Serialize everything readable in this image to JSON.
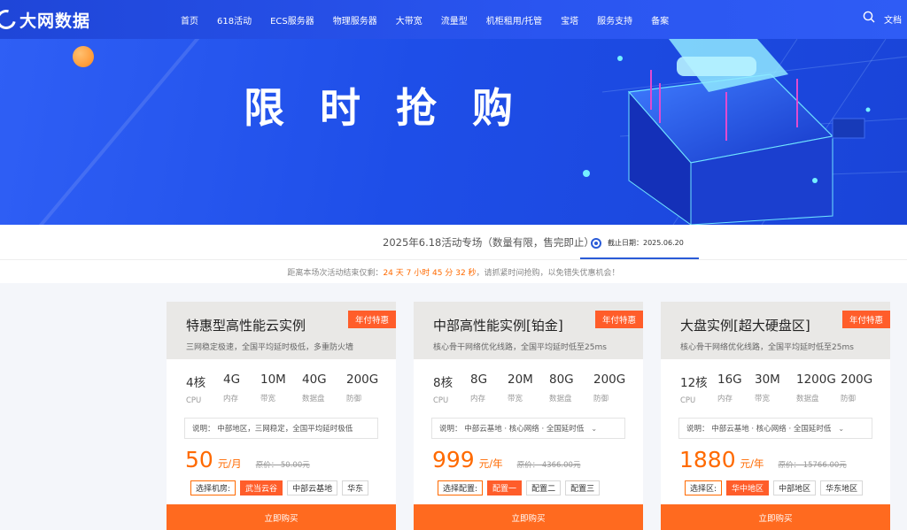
{
  "header": {
    "logo_text": "大网数据",
    "nav": [
      "首页",
      "618活动",
      "ECS服务器",
      "物理服务器",
      "大带宽",
      "流量型",
      "机柜租用/托管",
      "宝塔",
      "服务支持",
      "备案"
    ],
    "docs_label": "文档",
    "search_icon": "search-icon"
  },
  "banner": {
    "title": "限时抢购"
  },
  "info": {
    "campaign_title": "2025年6.18活动专场（数量有限，售完即止）",
    "deadline_label": "截止日期：2025.06.20",
    "countdown_prefix": "距离本场次活动结束仅剩：",
    "countdown_time": "24 天 7 小时 45 分 32 秒",
    "countdown_suffix": "，请抓紧时间抢购，以免错失优惠机会！"
  },
  "cards": [
    {
      "title": "特惠型高性能云实例",
      "badge": "年付特惠",
      "desc": "三网稳定极速，全国平均延时极低，多重防火墙",
      "specs": [
        {
          "value": "4核",
          "label": "CPU"
        },
        {
          "value": "4G",
          "label": "内存"
        },
        {
          "value": "10M",
          "label": "带宽"
        },
        {
          "value": "40G",
          "label": "数据盘"
        },
        {
          "value": "200G",
          "label": "防御"
        }
      ],
      "note": "说明：  中部地区，三网稳定，全国平均延时极低",
      "price": "50",
      "unit": "元/月",
      "orig": "原价：  50.00元",
      "options": [
        {
          "text": "选择机房:",
          "kind": "label"
        },
        {
          "text": "武当云谷",
          "kind": "active"
        },
        {
          "text": "中部云基地",
          "kind": "normal"
        },
        {
          "text": "华东",
          "kind": "normal"
        }
      ],
      "buy": "立即购买"
    },
    {
      "title": "中部高性能实例[铂金]",
      "badge": "年付特惠",
      "desc": "核心骨干网络优化线路，全国平均延时低至25ms",
      "specs": [
        {
          "value": "8核",
          "label": "CPU"
        },
        {
          "value": "8G",
          "label": "内存"
        },
        {
          "value": "20M",
          "label": "带宽"
        },
        {
          "value": "80G",
          "label": "数据盘"
        },
        {
          "value": "200G",
          "label": "防御"
        }
      ],
      "note": "说明：  中部云基地 · 核心网络 · 全国延时低",
      "price": "999",
      "unit": "元/年",
      "orig": "原价：  4366.00元",
      "options": [
        {
          "text": "选择配置:",
          "kind": "label"
        },
        {
          "text": "配置一",
          "kind": "active"
        },
        {
          "text": "配置二",
          "kind": "normal"
        },
        {
          "text": "配置三",
          "kind": "normal"
        }
      ],
      "buy": "立即购买"
    },
    {
      "title": "大盘实例[超大硬盘区]",
      "badge": "年付特惠",
      "desc": "核心骨干网络优化线路，全国平均延时低至25ms",
      "specs": [
        {
          "value": "12核",
          "label": "CPU"
        },
        {
          "value": "16G",
          "label": "内存"
        },
        {
          "value": "30M",
          "label": "带宽"
        },
        {
          "value": "1200G",
          "label": "数据盘"
        },
        {
          "value": "200G",
          "label": "防御"
        }
      ],
      "note": "说明：  中部云基地 · 核心网络 · 全国延时低",
      "price": "1880",
      "unit": "元/年",
      "orig": "原价：  15766.00元",
      "options": [
        {
          "text": "选择区:",
          "kind": "label"
        },
        {
          "text": "华中地区",
          "kind": "active"
        },
        {
          "text": "中部地区",
          "kind": "normal"
        },
        {
          "text": "华东地区",
          "kind": "normal"
        }
      ],
      "buy": "立即购买"
    }
  ]
}
